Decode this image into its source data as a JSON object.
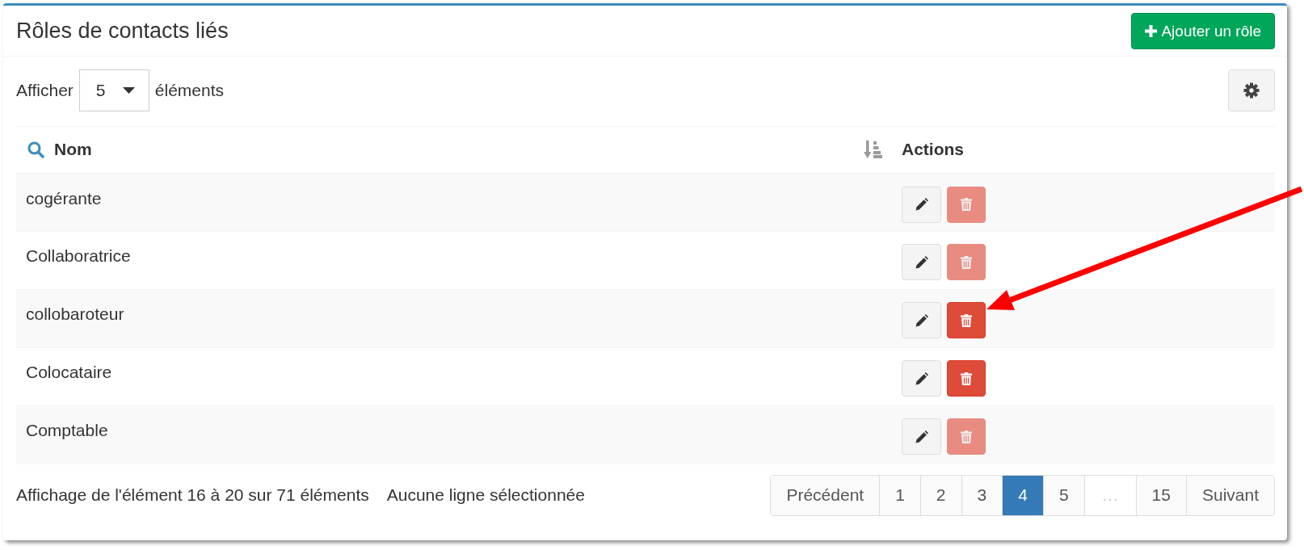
{
  "panel": {
    "title": "Rôles de contacts liés",
    "add_button": {
      "label": "Ajouter un rôle"
    }
  },
  "length_menu": {
    "label_before": "Afficher",
    "value": "5",
    "label_after": "éléments"
  },
  "table": {
    "columns": [
      {
        "label": "Nom",
        "searchable": true,
        "sortable": true
      },
      {
        "label": "Actions",
        "searchable": false,
        "sortable": false
      }
    ],
    "rows": [
      {
        "name": "cogérante",
        "delete_disabled": true
      },
      {
        "name": "Collaboratrice",
        "delete_disabled": true
      },
      {
        "name": "collobaroteur",
        "delete_disabled": false
      },
      {
        "name": "Colocataire",
        "delete_disabled": false
      },
      {
        "name": "Comptable",
        "delete_disabled": true
      }
    ]
  },
  "footer": {
    "info": "Affichage de l'élément 16 à 20 sur 71 éléments",
    "selection": "Aucune ligne sélectionnée"
  },
  "pagination": [
    {
      "label": "Précédent",
      "selected": false,
      "disabled": false
    },
    {
      "label": "1",
      "selected": false,
      "disabled": false
    },
    {
      "label": "2",
      "selected": false,
      "disabled": false
    },
    {
      "label": "3",
      "selected": false,
      "disabled": false
    },
    {
      "label": "4",
      "selected": true,
      "disabled": false
    },
    {
      "label": "5",
      "selected": false,
      "disabled": false
    },
    {
      "label": "…",
      "selected": false,
      "disabled": true
    },
    {
      "label": "15",
      "selected": false,
      "disabled": false
    },
    {
      "label": "Suivant",
      "selected": false,
      "disabled": false
    }
  ]
}
